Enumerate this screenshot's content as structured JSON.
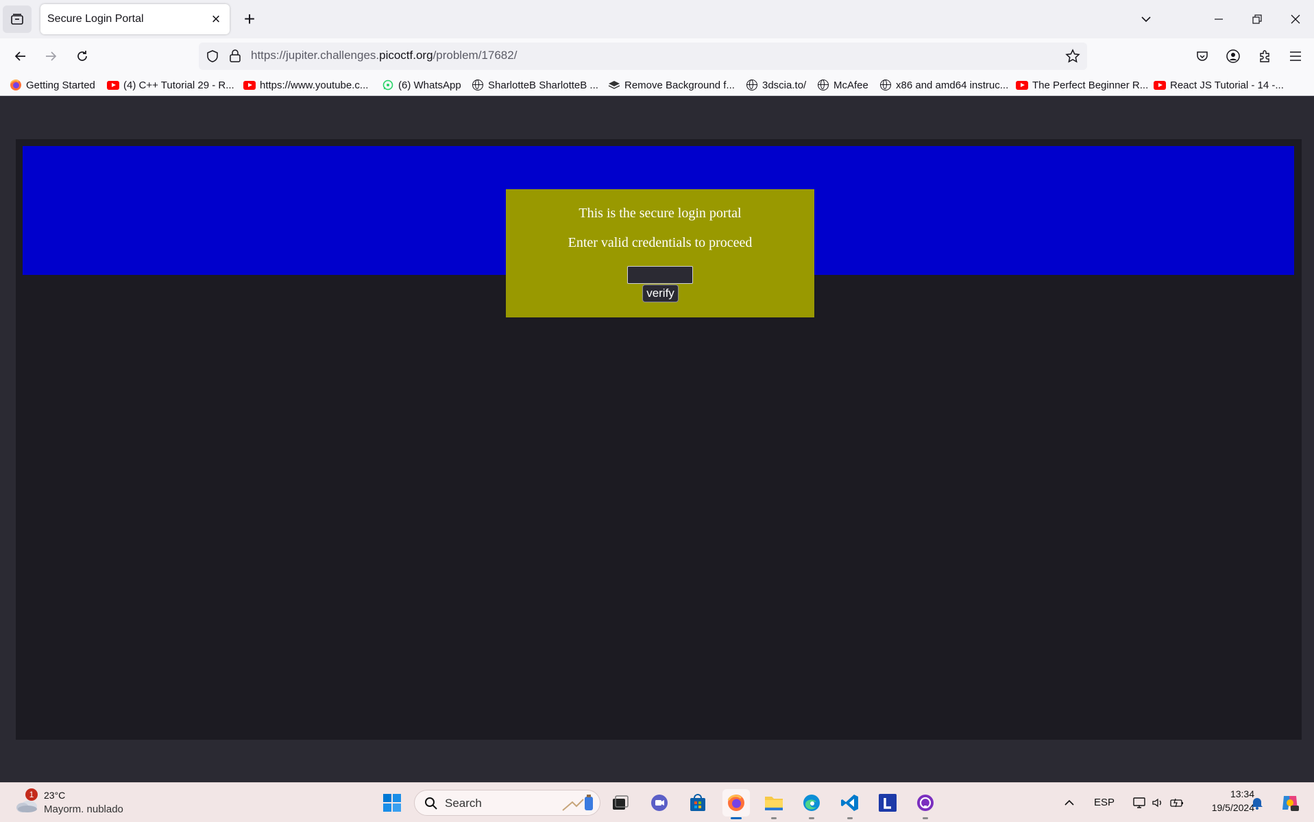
{
  "browser": {
    "tab_title": "Secure Login Portal",
    "url_prefix": "https://jupiter.challenges.",
    "url_domain": "picoctf.org",
    "url_path": "/problem/17682/"
  },
  "bookmarks": [
    {
      "label": "Getting Started",
      "icon": "firefox-icon"
    },
    {
      "label": "(4) C++ Tutorial 29 - R...",
      "icon": "youtube-icon"
    },
    {
      "label": "https://www.youtube.c...",
      "icon": "youtube-icon"
    },
    {
      "label": "(6) WhatsApp",
      "icon": "whatsapp-icon"
    },
    {
      "label": "SharlotteB SharlotteB ...",
      "icon": "globe-icon"
    },
    {
      "label": "Remove Background f...",
      "icon": "layers-icon"
    },
    {
      "label": "3dscia.to/",
      "icon": "globe-icon"
    },
    {
      "label": "McAfee",
      "icon": "globe-icon"
    },
    {
      "label": "x86 and amd64 instruc...",
      "icon": "globe-icon"
    },
    {
      "label": "The Perfect Beginner R...",
      "icon": "youtube-icon"
    },
    {
      "label": "React JS Tutorial - 14 -...",
      "icon": "youtube-icon"
    }
  ],
  "page": {
    "line1": "This is the secure login portal",
    "line2": "Enter valid credentials to proceed",
    "input_value": "",
    "verify_label": "verify",
    "colors": {
      "banner": "#0000cc",
      "box": "#999900",
      "frame": "#1c1b22"
    }
  },
  "taskbar": {
    "weather_badge": "1",
    "weather_temp": "23°C",
    "weather_desc": "Mayorm. nublado",
    "search_label": "Search",
    "language": "ESP",
    "time": "13:34",
    "date": "19/5/2024"
  }
}
